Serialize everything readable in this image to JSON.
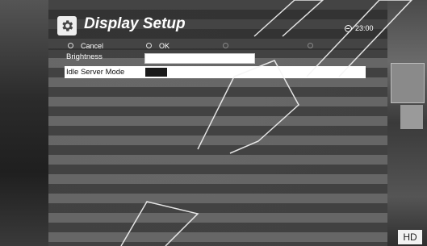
{
  "header": {
    "title": "Display Setup",
    "icon": "gear-icon",
    "clock_icon": "clock-icon",
    "time": "23:00"
  },
  "buttons": {
    "cancel_label": "Cancel",
    "ok_label": "OK"
  },
  "settings": [
    {
      "label": "Brightness",
      "value": ""
    },
    {
      "label": "Idle Server Mode",
      "value": ""
    }
  ],
  "badge": {
    "hd_label": "HD"
  },
  "colors": {
    "highlight": "#ffffff",
    "stripe_light": "#6e6e6e",
    "stripe_dark": "#464646",
    "text": "#ffffff"
  }
}
